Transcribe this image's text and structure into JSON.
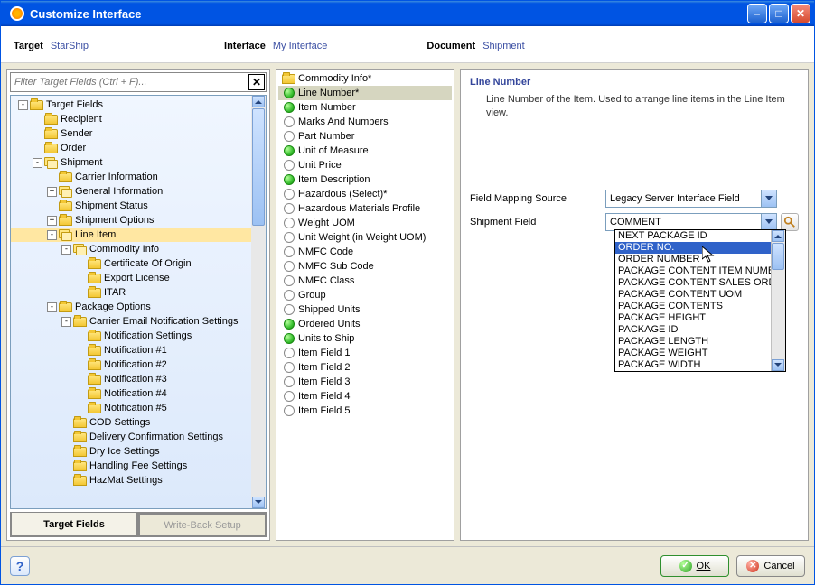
{
  "window": {
    "title": "Customize Interface"
  },
  "header": {
    "target_lbl": "Target",
    "target_val": "StarShip",
    "interface_lbl": "Interface",
    "interface_val": "My Interface",
    "document_lbl": "Document",
    "document_val": "Shipment"
  },
  "search": {
    "placeholder": "Filter Target Fields (Ctrl + F)..."
  },
  "tabs": {
    "target": "Target Fields",
    "writeback": "Write-Back Setup"
  },
  "tree": [
    {
      "d": 0,
      "exp": "-",
      "ico": "folder",
      "t": "Target Fields"
    },
    {
      "d": 1,
      "ico": "folder",
      "t": "Recipient"
    },
    {
      "d": 1,
      "ico": "folder",
      "t": "Sender"
    },
    {
      "d": 1,
      "ico": "folder",
      "t": "Order"
    },
    {
      "d": 1,
      "exp": "-",
      "ico": "fgroup",
      "t": "Shipment"
    },
    {
      "d": 2,
      "ico": "folder",
      "t": "Carrier Information"
    },
    {
      "d": 2,
      "exp": "+",
      "ico": "fgroup",
      "t": "General Information"
    },
    {
      "d": 2,
      "ico": "folder",
      "t": "Shipment Status"
    },
    {
      "d": 2,
      "exp": "+",
      "ico": "folder",
      "t": "Shipment Options"
    },
    {
      "d": 2,
      "exp": "-",
      "ico": "fgroup",
      "t": "Line Item",
      "sel": true
    },
    {
      "d": 3,
      "exp": "-",
      "ico": "fgroup",
      "t": "Commodity Info"
    },
    {
      "d": 4,
      "ico": "folder",
      "t": "Certificate Of Origin"
    },
    {
      "d": 4,
      "ico": "folder",
      "t": "Export License"
    },
    {
      "d": 4,
      "ico": "folder",
      "t": "ITAR"
    },
    {
      "d": 2,
      "exp": "-",
      "ico": "folder",
      "t": "Package Options"
    },
    {
      "d": 3,
      "exp": "-",
      "ico": "folder",
      "t": "Carrier Email Notification Settings"
    },
    {
      "d": 4,
      "ico": "folder",
      "t": "Notification Settings"
    },
    {
      "d": 4,
      "ico": "folder",
      "t": "Notification #1"
    },
    {
      "d": 4,
      "ico": "folder",
      "t": "Notification #2"
    },
    {
      "d": 4,
      "ico": "folder",
      "t": "Notification #3"
    },
    {
      "d": 4,
      "ico": "folder",
      "t": "Notification #4"
    },
    {
      "d": 4,
      "ico": "folder",
      "t": "Notification #5"
    },
    {
      "d": 3,
      "ico": "folder",
      "t": "COD Settings"
    },
    {
      "d": 3,
      "ico": "folder",
      "t": "Delivery Confirmation Settings"
    },
    {
      "d": 3,
      "ico": "folder",
      "t": "Dry Ice Settings"
    },
    {
      "d": 3,
      "ico": "folder",
      "t": "Handling Fee Settings"
    },
    {
      "d": 3,
      "ico": "folder",
      "t": "HazMat Settings"
    }
  ],
  "mid_header": {
    "ico": "folder",
    "t": "Commodity Info*"
  },
  "mid": [
    {
      "g": true,
      "t": "Line Number*",
      "sel": true
    },
    {
      "g": true,
      "t": "Item Number"
    },
    {
      "g": false,
      "t": "Marks And Numbers"
    },
    {
      "g": false,
      "t": "Part Number"
    },
    {
      "g": true,
      "t": "Unit of Measure"
    },
    {
      "g": false,
      "t": "Unit Price"
    },
    {
      "g": true,
      "t": "Item Description"
    },
    {
      "g": false,
      "t": "Hazardous (Select)*"
    },
    {
      "g": false,
      "t": "Hazardous Materials Profile"
    },
    {
      "g": false,
      "t": "Weight UOM"
    },
    {
      "g": false,
      "t": "Unit Weight (in Weight UOM)"
    },
    {
      "g": false,
      "t": "NMFC Code"
    },
    {
      "g": false,
      "t": "NMFC Sub Code"
    },
    {
      "g": false,
      "t": "NMFC Class"
    },
    {
      "g": false,
      "t": "Group"
    },
    {
      "g": false,
      "t": "Shipped Units"
    },
    {
      "g": true,
      "t": "Ordered Units"
    },
    {
      "g": true,
      "t": "Units to Ship"
    },
    {
      "g": false,
      "t": "Item Field 1"
    },
    {
      "g": false,
      "t": "Item Field 2"
    },
    {
      "g": false,
      "t": "Item Field 3"
    },
    {
      "g": false,
      "t": "Item Field 4"
    },
    {
      "g": false,
      "t": "Item Field 5"
    }
  ],
  "detail": {
    "title": "Line Number",
    "desc": "Line Number of the Item. Used to arrange line items in the Line Item view.",
    "src_lbl": "Field Mapping Source",
    "src_val": "Legacy Server Interface Field",
    "ship_lbl": "Shipment Field",
    "ship_val": "COMMENT"
  },
  "dropdown": [
    "NEXT PACKAGE ID",
    "ORDER NO.",
    "ORDER NUMBER",
    "PACKAGE CONTENT ITEM NUMBER",
    "PACKAGE CONTENT SALES ORDER",
    "PACKAGE CONTENT UOM",
    "PACKAGE CONTENTS",
    "PACKAGE HEIGHT",
    "PACKAGE ID",
    "PACKAGE LENGTH",
    "PACKAGE WEIGHT",
    "PACKAGE WIDTH"
  ],
  "dropdown_hl": 1,
  "footer": {
    "ok": "OK",
    "cancel": "Cancel"
  }
}
